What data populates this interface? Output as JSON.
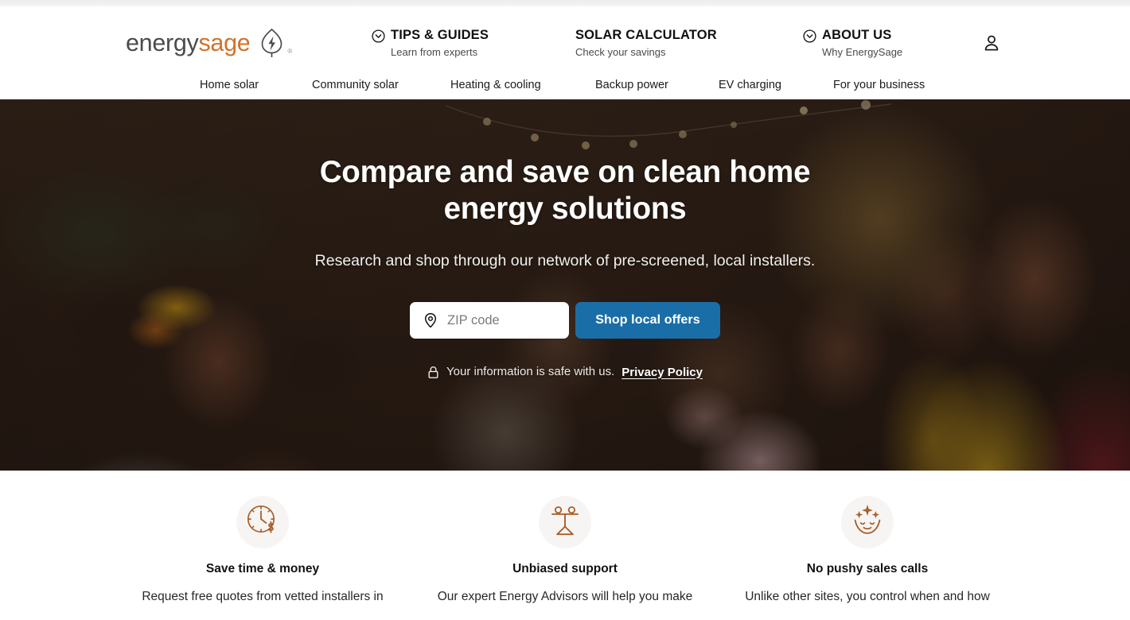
{
  "brand": {
    "logo_first": "energy",
    "logo_second": "sage",
    "logo_mark": "leaf-bolt-icon",
    "registered_mark": "®",
    "accent_orange": "#d2712a",
    "logo_gray": "#4b4b4d",
    "cta_blue": "#1a6ea8",
    "icon_brown": "#a85f2b"
  },
  "header": {
    "account_icon": "user-icon",
    "items": [
      {
        "title": "TIPS & GUIDES",
        "subtitle": "Learn from experts",
        "icon": "chevron-down-circle-icon",
        "has_icon": true
      },
      {
        "title": "SOLAR CALCULATOR",
        "subtitle": "Check your savings",
        "icon": "",
        "has_icon": false
      },
      {
        "title": "ABOUT US",
        "subtitle": "Why EnergySage",
        "icon": "chevron-down-circle-icon",
        "has_icon": true
      }
    ]
  },
  "subnav": {
    "items": [
      {
        "label": "Home solar"
      },
      {
        "label": "Community solar"
      },
      {
        "label": "Heating & cooling"
      },
      {
        "label": "Backup power"
      },
      {
        "label": "EV charging"
      },
      {
        "label": "For your business"
      }
    ]
  },
  "hero": {
    "headline": "Compare and save on clean home energy solutions",
    "subheadline": "Research and shop through our network of pre-screened, local installers.",
    "zip": {
      "placeholder": "ZIP code",
      "value": "",
      "icon": "map-pin-icon"
    },
    "cta_label": "Shop local offers",
    "safety": {
      "icon": "lock-icon",
      "text": "Your information is safe with us.",
      "link_label": "Privacy Policy"
    }
  },
  "benefits": [
    {
      "icon": "clock-dollar-icon",
      "title": "Save time & money",
      "body": "Request free quotes from vetted installers in"
    },
    {
      "icon": "balance-scale-icon",
      "title": "Unbiased support",
      "body": "Our expert Energy Advisors will help you make"
    },
    {
      "icon": "calm-face-sparkles-icon",
      "title": "No pushy sales calls",
      "body": "Unlike other sites, you control when and how"
    }
  ]
}
